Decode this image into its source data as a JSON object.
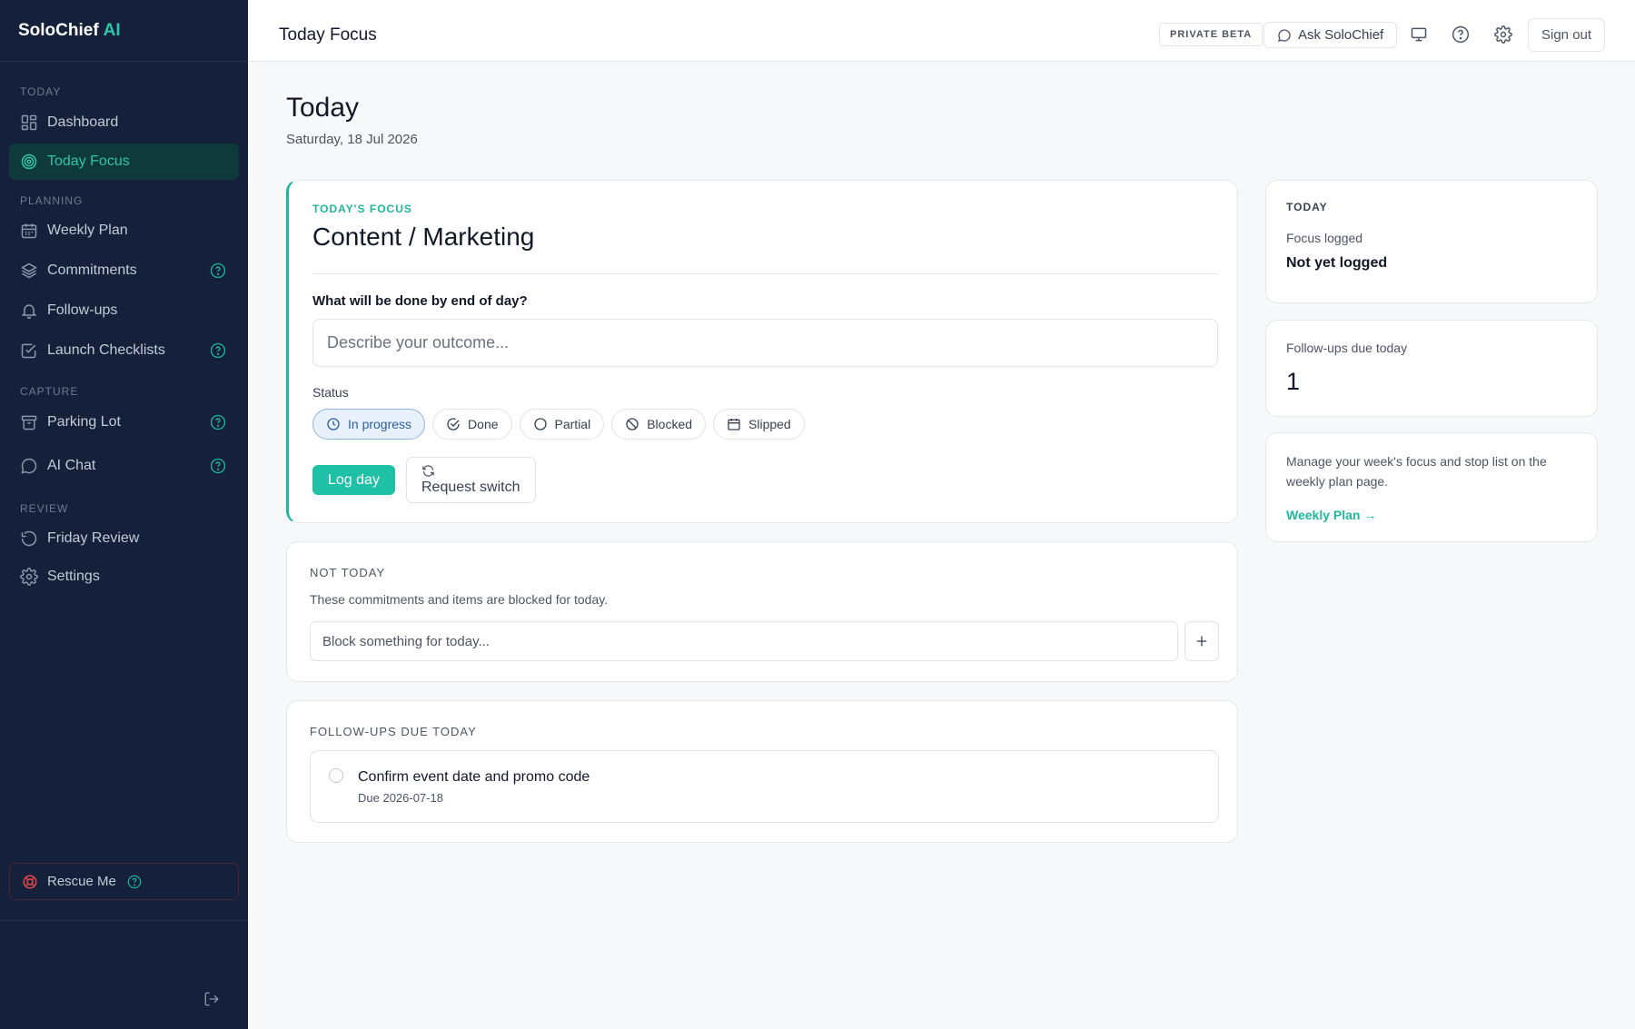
{
  "brand": {
    "name": "SoloChief",
    "accent": "AI"
  },
  "sidebar": {
    "sections": [
      "TODAY",
      "PLANNING",
      "CAPTURE",
      "REVIEW"
    ],
    "items": [
      {
        "label": "Dashboard",
        "icon": "dashboard-icon"
      },
      {
        "label": "Today Focus",
        "icon": "target-icon",
        "active": true
      },
      {
        "label": "Weekly Plan",
        "icon": "calendar-icon"
      },
      {
        "label": "Commitments",
        "icon": "layers-icon",
        "help": true
      },
      {
        "label": "Follow-ups",
        "icon": "bell-icon"
      },
      {
        "label": "Launch Checklists",
        "icon": "checkbox-icon",
        "help": true
      },
      {
        "label": "Parking Lot",
        "icon": "archive-icon",
        "help": true
      },
      {
        "label": "AI Chat",
        "icon": "chat-icon",
        "help": true
      },
      {
        "label": "Friday Review",
        "icon": "history-icon"
      },
      {
        "label": "Settings",
        "icon": "gear-icon"
      }
    ],
    "rescue_label": "Rescue Me"
  },
  "topbar": {
    "title": "Today Focus",
    "beta_badge": "PRIVATE BETA",
    "ask_label": "Ask SoloChief",
    "signout_label": "Sign out"
  },
  "page": {
    "title": "Today",
    "date": "Saturday, 18 Jul 2026"
  },
  "focus": {
    "label": "TODAY'S FOCUS",
    "title": "Content / Marketing",
    "question": "What will be done by end of day?",
    "outcome_placeholder": "Describe your outcome...",
    "status_label": "Status",
    "statuses": [
      {
        "label": "In progress",
        "icon": "clock-icon",
        "selected": true
      },
      {
        "label": "Done",
        "icon": "check-circle-icon"
      },
      {
        "label": "Partial",
        "icon": "circle-icon"
      },
      {
        "label": "Blocked",
        "icon": "blocked-icon"
      },
      {
        "label": "Slipped",
        "icon": "calendar-icon"
      }
    ],
    "log_button": "Log day",
    "switch_button": "Request switch"
  },
  "not_today": {
    "label": "NOT TODAY",
    "description": "These commitments and items are blocked for today.",
    "placeholder": "Block something for today..."
  },
  "followups": {
    "label": "FOLLOW-UPS DUE TODAY",
    "items": [
      {
        "title": "Confirm event date and promo code",
        "due": "Due 2026-07-18"
      }
    ]
  },
  "right": {
    "today_label": "TODAY",
    "focus_logged_label": "Focus logged",
    "focus_logged_value": "Not yet logged",
    "followups_due_label": "Follow-ups due today",
    "followups_due_value": "1",
    "weekly_text": "Manage your week's focus and stop list on the weekly plan page.",
    "weekly_link": "Weekly Plan →"
  },
  "colors": {
    "sidebar_bg": "#15213a",
    "accent": "#2ec4a9",
    "primary_button": "#1fc1a6",
    "danger": "#e5484d",
    "selected_chip": "#e8f1fb"
  }
}
